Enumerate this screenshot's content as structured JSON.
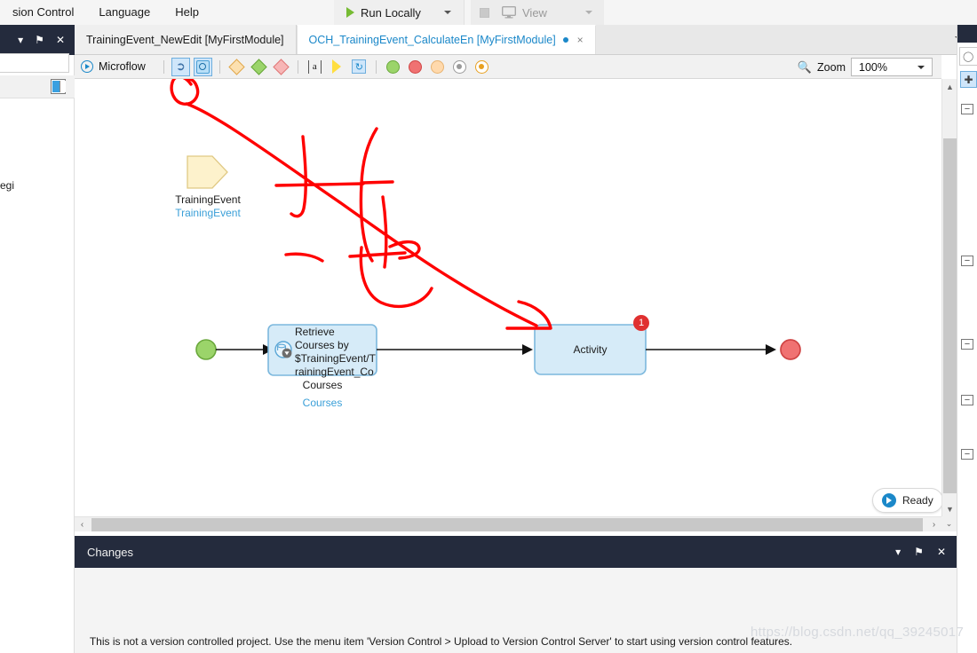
{
  "menubar": {
    "items": [
      {
        "label": "sion Control",
        "name": "menu-version-control"
      },
      {
        "label": "Language",
        "name": "menu-language"
      },
      {
        "label": "Help",
        "name": "menu-help"
      }
    ],
    "run_label": "Run Locally",
    "view_label": "View",
    "run_icon": "play-icon",
    "stop_icon": "stop-icon",
    "monitor_icon": "monitor-icon"
  },
  "left_dock": {
    "collapse_icon": "chevron-down-icon",
    "pin_icon": "pin-icon",
    "close_icon": "close-icon",
    "tree_text": "egi",
    "dock_icon": "dock-left-icon"
  },
  "tabs": [
    {
      "label": "TrainingEvent_NewEdit [MyFirstModule]",
      "active": false,
      "dirty": false,
      "closable": false
    },
    {
      "label": "OCH_TrainingEvent_CalculateEn [MyFirstModule]",
      "active": true,
      "dirty": true,
      "closable": true
    }
  ],
  "tab_close_glyph": "×",
  "editor_toolbar": {
    "title": "Microflow",
    "title_icon": "microflow-icon",
    "buttons": [
      {
        "name": "select-cursor-tool",
        "icon": "cursor-icon",
        "selected": true
      },
      {
        "name": "microflow-call-tool",
        "icon": "microflow-call-icon",
        "selected": true,
        "highlighted": true
      },
      {
        "name": "split-decision-tool",
        "icon": "diamond-orange-icon"
      },
      {
        "name": "merge-tool",
        "icon": "diamond-green-icon"
      },
      {
        "name": "error-handler-tool",
        "icon": "diamond-pink-icon"
      },
      {
        "name": "annotation-tool",
        "icon": "text-a-icon"
      },
      {
        "name": "parameter-tool",
        "icon": "yellow-arrow-icon"
      },
      {
        "name": "loop-tool",
        "icon": "loop-icon"
      },
      {
        "name": "start-event-tool",
        "icon": "circle-green-icon"
      },
      {
        "name": "end-event-tool",
        "icon": "circle-red-icon"
      },
      {
        "name": "continue-event-tool",
        "icon": "circle-peach-icon"
      },
      {
        "name": "break-event-tool",
        "icon": "circle-grey-icon"
      },
      {
        "name": "error-event-tool",
        "icon": "circle-amber-icon"
      }
    ],
    "zoom_label": "Zoom",
    "zoom_value": "100%",
    "zoom_icon": "magnifier-icon"
  },
  "canvas": {
    "parameter": {
      "name_label": "TrainingEvent",
      "type_label": "TrainingEvent"
    },
    "retrieve_activity": {
      "lines": [
        "Retrieve",
        "Courses by",
        "$TrainingEvent/T",
        "rainingEvent_Co"
      ],
      "name_label": "Courses",
      "type_label": "Courses",
      "icon": "retrieve-database-icon"
    },
    "generic_activity": {
      "label": "Activity",
      "badge": "1"
    },
    "start_node": "start-event",
    "end_node": "end-event",
    "annotation_text": "拖",
    "ready_badge": {
      "label": "Ready",
      "icon": "play-circle-icon"
    }
  },
  "scrollbars": {
    "up_glyph": "▲",
    "down_glyph": "▼",
    "left_glyph": "‹",
    "right_glyph": "›",
    "corner_glyph": "⌄"
  },
  "right_panel": {
    "search_icon": "search-icon",
    "add_icon": "plus-icon",
    "collapse_icons": [
      "collapse-icon",
      "collapse-icon",
      "collapse-icon",
      "collapse-icon",
      "collapse-icon"
    ]
  },
  "changes_panel": {
    "title": "Changes",
    "collapse_icon": "chevron-down-icon",
    "pin_icon": "pin-icon",
    "close_icon": "close-icon",
    "collapse_glyph": "▾",
    "pin_glyph": "⚑",
    "close_glyph": "✕"
  },
  "status_message": "This is not a version controlled project. Use the menu item 'Version Control > Upload to Version Control Server' to start using version control features.",
  "watermark": "https://blog.csdn.net/qq_39245017",
  "colors": {
    "dark_panel": "#242b3d",
    "accent_blue": "#1b88c9",
    "activity_fill": "#d6ebf8",
    "activity_stroke": "#7cb8dd",
    "annotation_red": "#ff0000",
    "start_green": "#9bd46a",
    "end_red": "#f07272",
    "param_yellow": "#fdf2cc"
  }
}
